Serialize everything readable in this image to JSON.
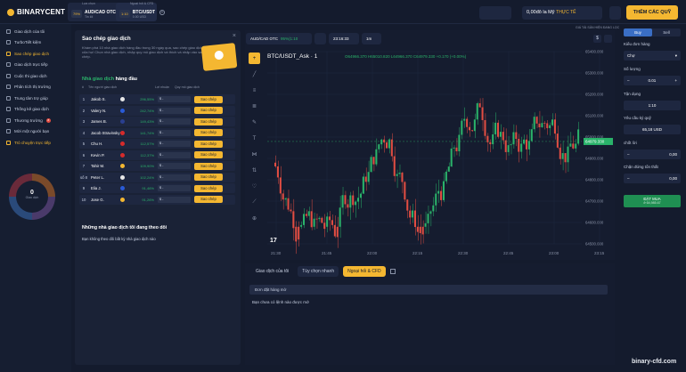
{
  "brand": "BINARYCENT",
  "tabs": [
    {
      "caption": "Lựa chọn",
      "pct": "79%",
      "name": "AUD/CAD OTC",
      "sub": "Tin lối"
    },
    {
      "caption": "Ngoại hối & CFD",
      "pct": "1:10",
      "name": "BTC/USDT",
      "sub": "0.00 USD"
    }
  ],
  "balance": {
    "amount": "0,00đô la Mỹ",
    "mode": "THỰC TẾ"
  },
  "add_funds": "THÊM CÁC QUỸ",
  "sidebar": [
    "Giao dịch của tôi",
    "TurboTiết kiệm",
    "Sao chép giao dịch",
    "Giao dịch trực tiếp",
    "Cuộc thi giao dịch",
    "Phân tích thị trường",
    "Trung tâm trợ giúp",
    "Thống kê giao dịch",
    "Thương trường",
    "Mời một người bạn",
    "Trò chuyện trực tiếp"
  ],
  "sidebar_badges": [
    "",
    "",
    "",
    "",
    "",
    "",
    "",
    "",
    "8",
    "",
    ""
  ],
  "donut": {
    "value": "0",
    "label": "Giao dịch"
  },
  "panel": {
    "title": "Sao chép giao dịch",
    "close": "×",
    "desc": "Khám phá 10 nhà giao dịch hàng đầu trong 30 ngày qua, sao chép giao dịch của họ! Chọn nhà giao dịch, nhập quy mô giao dịch và thích và nhập vào sao chép.",
    "top_title_a": "Nhà giao dịch",
    "top_title_b": "hàng đầu",
    "cols": [
      "#",
      "Tên người giao dịch",
      "Lợi nhuận",
      "Quy mô giao dịch"
    ],
    "traders": [
      {
        "rank": "1",
        "name": "Jakob S.",
        "profit": "296,55%",
        "flag": "#e8e8e8"
      },
      {
        "rank": "2",
        "name": "Valery N.",
        "profit": "242,74%",
        "flag": "#2a5bd7"
      },
      {
        "rank": "3",
        "name": "James B.",
        "profit": "149,43%",
        "flag": "#2a3f8f"
      },
      {
        "rank": "4",
        "name": "Jacob Stravinsky",
        "profit": "141,74%",
        "flag": "#d62b2b"
      },
      {
        "rank": "5",
        "name": "Chu H.",
        "profit": "112,57%",
        "flag": "#d62b2b"
      },
      {
        "rank": "6",
        "name": "Kevin P.",
        "profit": "112,37%",
        "flag": "#d62b2b"
      },
      {
        "rank": "7",
        "name": "Tahir M.",
        "profit": "109,90%",
        "flag": "#f4b731"
      },
      {
        "rank": "số 8",
        "name": "Peter L.",
        "profit": "102,24%",
        "flag": "#e8e8e8"
      },
      {
        "rank": "9",
        "name": "Elia J.",
        "profit": "91,46%",
        "flag": "#2a5bd7"
      },
      {
        "rank": "10",
        "name": "Jose G.",
        "profit": "91,26%",
        "flag": "#f4b731"
      }
    ],
    "amount_placeholder": "$ -",
    "copy_label": "Sao chép",
    "following_title": "Những nhà giao dịch tôi đang theo dõi",
    "following_none": "Bạn không theo dõi bất kỳ nhà giao dịch nào"
  },
  "chart": {
    "pair": "AUD/CAD OTC",
    "pair_value": "95%(1:10",
    "time": "23:16:33",
    "interval": "1m",
    "title": "BTC/USDT_Ask · 1",
    "ohlc": {
      "o": "O64966.370",
      "h": "H65010.820",
      "l": "L64966.370",
      "c": "C64979.330 +0.170 (+0.00%)"
    },
    "asset_label": "GIÁ TÀI SẢN HIỆN ĐANG LỌC",
    "y_ticks": [
      "65400.000",
      "65300.000",
      "65200.000",
      "65100.000",
      "65000.000",
      "64900.000",
      "64800.000",
      "64700.000",
      "64600.000",
      "64500.000"
    ],
    "x_ticks": [
      "21:45",
      "22:00",
      "22:15",
      "22:30",
      "22:45",
      "23:00",
      "23:15"
    ],
    "x_extra": "21:30",
    "current": "64979.330"
  },
  "orders": {
    "title": "Giao dịch của tôi",
    "tab_quick": "Tùy chọn nhanh",
    "tab_cfd": "Ngoại hối & CFD",
    "pending": "Đơn đặt hàng mở",
    "none": "Bạn chưa có lệnh nào được mở"
  },
  "right": {
    "buy": "Buy",
    "sell": "Sell",
    "order_type_label": "Kiểu đơn hàng",
    "order_type": "Chợ",
    "qty_label": "Số lượng",
    "qty": "0.01",
    "leverage_label": "Tận dụng",
    "leverage": "1:10",
    "funds_label": "Yêu cầu ký quỹ",
    "funds": "65,18 USD",
    "sl_label": "chốt lời",
    "sl": "0,00",
    "tp_label": "Chặn đứng tổn thất",
    "tp": "0,00",
    "buy_btn": "ĐẶT MUA",
    "buy_sub": "ở 64,985.67"
  },
  "watermark": "binary-cfd.com"
}
